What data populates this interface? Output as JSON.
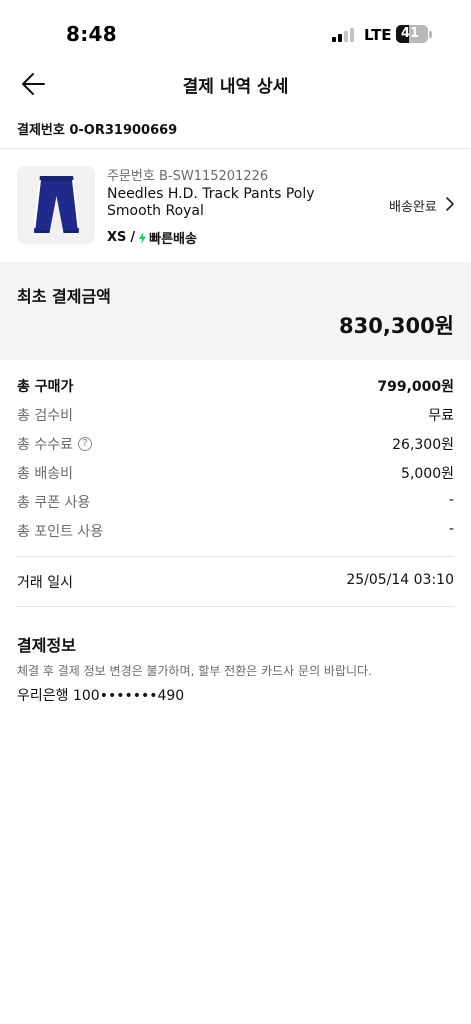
{
  "status_bar": {
    "time": "8:48",
    "network": "LTE",
    "battery_level": "41"
  },
  "nav": {
    "title": "결제 내역 상세",
    "back_icon": "arrow-left-icon"
  },
  "payment_number": "결제번호 0-OR31900669",
  "product": {
    "order_number": "주문번호 B-SW115201226",
    "name": "Needles H.D. Track Pants Poly Smooth Royal",
    "size": "XS",
    "separator": "/",
    "shipping_badge": "빠른배송",
    "shipping_icon": "lightning-bolt-icon",
    "status": "배송완료",
    "status_icon": "chevron-right-icon",
    "image_icon": "track-pants-thumbnail",
    "colors": {
      "pants": "#1f2a8c",
      "stripe": "#ffffff",
      "bolt": "#22c55e"
    }
  },
  "initial_payment": {
    "label": "최초 결제금액",
    "amount": "830,300원"
  },
  "breakdown": {
    "total_purchase": {
      "label": "총 구매가",
      "value": "799,000원"
    },
    "inspection_fee": {
      "label": "총 검수비",
      "value": "무료"
    },
    "commission": {
      "label": "총 수수료",
      "value": "26,300원",
      "help_icon": "question-circle-icon",
      "help_glyph": "?"
    },
    "shipping_fee": {
      "label": "총 배송비",
      "value": "5,000원"
    },
    "coupon": {
      "label": "총 쿠폰 사용",
      "value": "-"
    },
    "points": {
      "label": "총 포인트 사용",
      "value": "-"
    }
  },
  "transaction": {
    "label": "거래 일시",
    "value": "25/05/14 03:10"
  },
  "payment_info": {
    "title": "결제정보",
    "note": "체결 후 결제 정보 변경은 불가하며, 할부 전환은 카드사 문의 바랍니다.",
    "account": "우리은행 100•••••••490"
  }
}
